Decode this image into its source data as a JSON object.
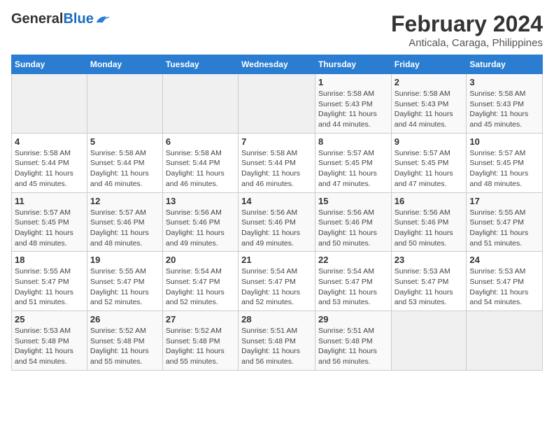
{
  "header": {
    "logo_general": "General",
    "logo_blue": "Blue",
    "month_year": "February 2024",
    "location": "Anticala, Caraga, Philippines"
  },
  "days_of_week": [
    "Sunday",
    "Monday",
    "Tuesday",
    "Wednesday",
    "Thursday",
    "Friday",
    "Saturday"
  ],
  "weeks": [
    [
      {
        "day": "",
        "details": ""
      },
      {
        "day": "",
        "details": ""
      },
      {
        "day": "",
        "details": ""
      },
      {
        "day": "",
        "details": ""
      },
      {
        "day": "1",
        "details": "Sunrise: 5:58 AM\nSunset: 5:43 PM\nDaylight: 11 hours and 44 minutes."
      },
      {
        "day": "2",
        "details": "Sunrise: 5:58 AM\nSunset: 5:43 PM\nDaylight: 11 hours and 44 minutes."
      },
      {
        "day": "3",
        "details": "Sunrise: 5:58 AM\nSunset: 5:43 PM\nDaylight: 11 hours and 45 minutes."
      }
    ],
    [
      {
        "day": "4",
        "details": "Sunrise: 5:58 AM\nSunset: 5:44 PM\nDaylight: 11 hours and 45 minutes."
      },
      {
        "day": "5",
        "details": "Sunrise: 5:58 AM\nSunset: 5:44 PM\nDaylight: 11 hours and 46 minutes."
      },
      {
        "day": "6",
        "details": "Sunrise: 5:58 AM\nSunset: 5:44 PM\nDaylight: 11 hours and 46 minutes."
      },
      {
        "day": "7",
        "details": "Sunrise: 5:58 AM\nSunset: 5:44 PM\nDaylight: 11 hours and 46 minutes."
      },
      {
        "day": "8",
        "details": "Sunrise: 5:57 AM\nSunset: 5:45 PM\nDaylight: 11 hours and 47 minutes."
      },
      {
        "day": "9",
        "details": "Sunrise: 5:57 AM\nSunset: 5:45 PM\nDaylight: 11 hours and 47 minutes."
      },
      {
        "day": "10",
        "details": "Sunrise: 5:57 AM\nSunset: 5:45 PM\nDaylight: 11 hours and 48 minutes."
      }
    ],
    [
      {
        "day": "11",
        "details": "Sunrise: 5:57 AM\nSunset: 5:45 PM\nDaylight: 11 hours and 48 minutes."
      },
      {
        "day": "12",
        "details": "Sunrise: 5:57 AM\nSunset: 5:46 PM\nDaylight: 11 hours and 48 minutes."
      },
      {
        "day": "13",
        "details": "Sunrise: 5:56 AM\nSunset: 5:46 PM\nDaylight: 11 hours and 49 minutes."
      },
      {
        "day": "14",
        "details": "Sunrise: 5:56 AM\nSunset: 5:46 PM\nDaylight: 11 hours and 49 minutes."
      },
      {
        "day": "15",
        "details": "Sunrise: 5:56 AM\nSunset: 5:46 PM\nDaylight: 11 hours and 50 minutes."
      },
      {
        "day": "16",
        "details": "Sunrise: 5:56 AM\nSunset: 5:46 PM\nDaylight: 11 hours and 50 minutes."
      },
      {
        "day": "17",
        "details": "Sunrise: 5:55 AM\nSunset: 5:47 PM\nDaylight: 11 hours and 51 minutes."
      }
    ],
    [
      {
        "day": "18",
        "details": "Sunrise: 5:55 AM\nSunset: 5:47 PM\nDaylight: 11 hours and 51 minutes."
      },
      {
        "day": "19",
        "details": "Sunrise: 5:55 AM\nSunset: 5:47 PM\nDaylight: 11 hours and 52 minutes."
      },
      {
        "day": "20",
        "details": "Sunrise: 5:54 AM\nSunset: 5:47 PM\nDaylight: 11 hours and 52 minutes."
      },
      {
        "day": "21",
        "details": "Sunrise: 5:54 AM\nSunset: 5:47 PM\nDaylight: 11 hours and 52 minutes."
      },
      {
        "day": "22",
        "details": "Sunrise: 5:54 AM\nSunset: 5:47 PM\nDaylight: 11 hours and 53 minutes."
      },
      {
        "day": "23",
        "details": "Sunrise: 5:53 AM\nSunset: 5:47 PM\nDaylight: 11 hours and 53 minutes."
      },
      {
        "day": "24",
        "details": "Sunrise: 5:53 AM\nSunset: 5:47 PM\nDaylight: 11 hours and 54 minutes."
      }
    ],
    [
      {
        "day": "25",
        "details": "Sunrise: 5:53 AM\nSunset: 5:48 PM\nDaylight: 11 hours and 54 minutes."
      },
      {
        "day": "26",
        "details": "Sunrise: 5:52 AM\nSunset: 5:48 PM\nDaylight: 11 hours and 55 minutes."
      },
      {
        "day": "27",
        "details": "Sunrise: 5:52 AM\nSunset: 5:48 PM\nDaylight: 11 hours and 55 minutes."
      },
      {
        "day": "28",
        "details": "Sunrise: 5:51 AM\nSunset: 5:48 PM\nDaylight: 11 hours and 56 minutes."
      },
      {
        "day": "29",
        "details": "Sunrise: 5:51 AM\nSunset: 5:48 PM\nDaylight: 11 hours and 56 minutes."
      },
      {
        "day": "",
        "details": ""
      },
      {
        "day": "",
        "details": ""
      }
    ]
  ]
}
